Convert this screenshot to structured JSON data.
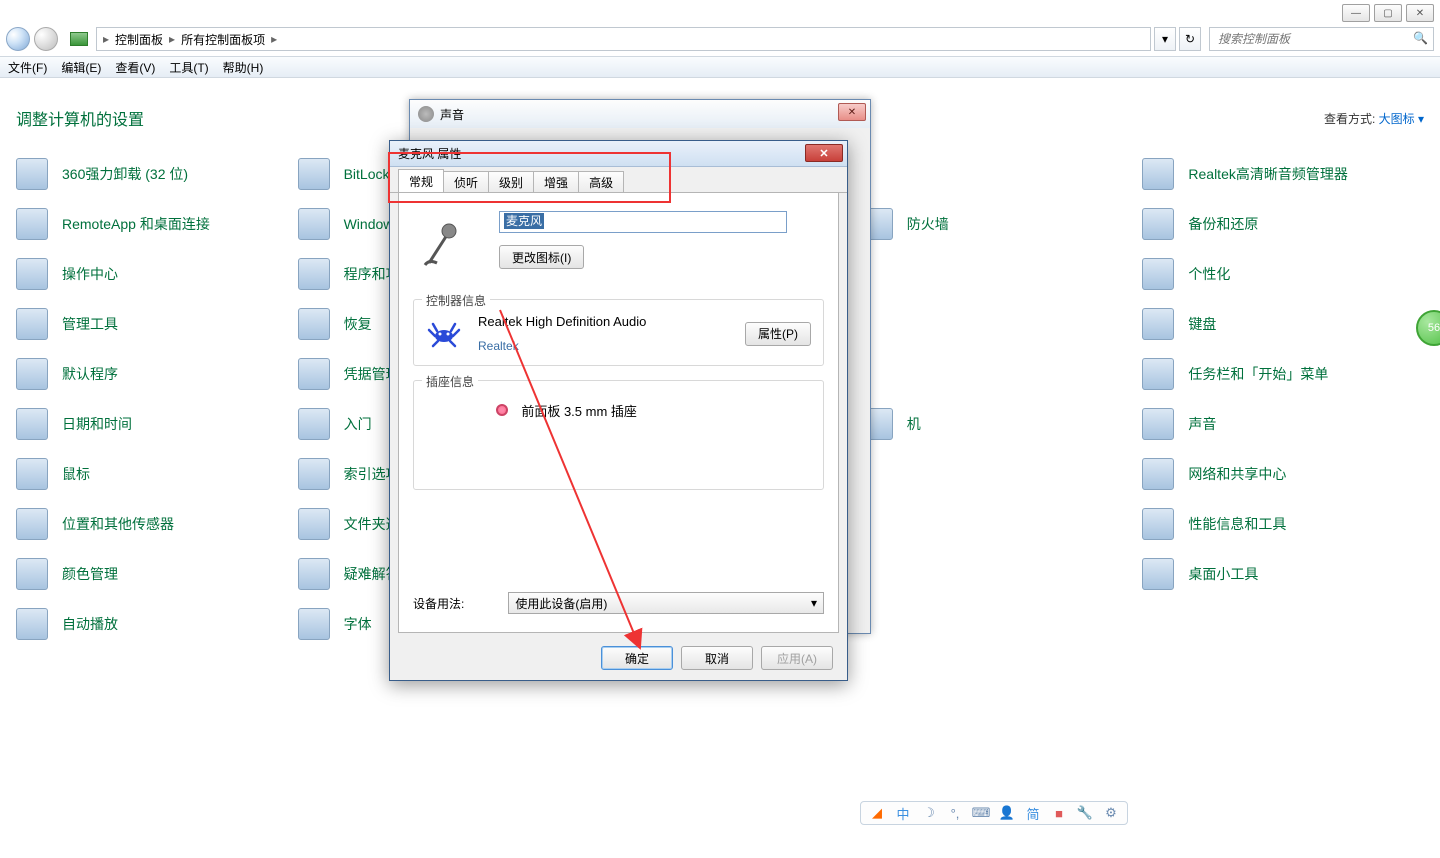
{
  "window_controls": {
    "min": "—",
    "max": "▢",
    "close": "✕"
  },
  "breadcrumb": {
    "lvl1": "控制面板",
    "lvl2": "所有控制面板项"
  },
  "search": {
    "placeholder": "搜索控制面板"
  },
  "menu": {
    "file": "文件(F)",
    "edit": "编辑(E)",
    "view": "查看(V)",
    "tools": "工具(T)",
    "help": "帮助(H)"
  },
  "page": {
    "title": "调整计算机的设置",
    "view_label": "查看方式:",
    "view_value": "大图标 ▾"
  },
  "items": [
    "360强力卸载 (32 位)",
    "BitLocker 驱",
    "",
    "",
    "Realtek高清晰音频管理器",
    "RemoteApp 和桌面连接",
    "Windows C",
    "",
    "防火墙",
    "备份和还原",
    "操作中心",
    "程序和功能",
    "",
    "",
    "个性化",
    "管理工具",
    "恢复",
    "",
    "",
    "键盘",
    "默认程序",
    "凭据管理器",
    "",
    "",
    "任务栏和「开始」菜单",
    "日期和时间",
    "入门",
    "",
    "机",
    "声音",
    "鼠标",
    "索引选项",
    "",
    "",
    "网络和共享中心",
    "位置和其他传感器",
    "文件夹选项",
    "",
    "",
    "性能信息和工具",
    "颜色管理",
    "疑难解答",
    "",
    "",
    "桌面小工具",
    "自动播放",
    "字体",
    "",
    "",
    ""
  ],
  "sound_dialog": {
    "title": "声音"
  },
  "mic_dialog": {
    "title": "麦克风 属性",
    "tabs": {
      "general": "常规",
      "listen": "侦听",
      "levels": "级别",
      "enhance": "增强",
      "advanced": "高级"
    },
    "name_value": "麦克风",
    "change_icon_btn": "更改图标(I)",
    "controller_group": "控制器信息",
    "controller_name": "Realtek High Definition Audio",
    "controller_vendor": "Realtek",
    "properties_btn": "属性(P)",
    "jack_group": "插座信息",
    "jack_text": "前面板 3.5 mm 插座",
    "usage_label": "设备用法:",
    "usage_value": "使用此设备(启用)",
    "ok": "确定",
    "cancel": "取消",
    "apply": "应用(A)"
  },
  "tray": {
    "t1": "中",
    "t2": "简"
  },
  "badge": "56"
}
